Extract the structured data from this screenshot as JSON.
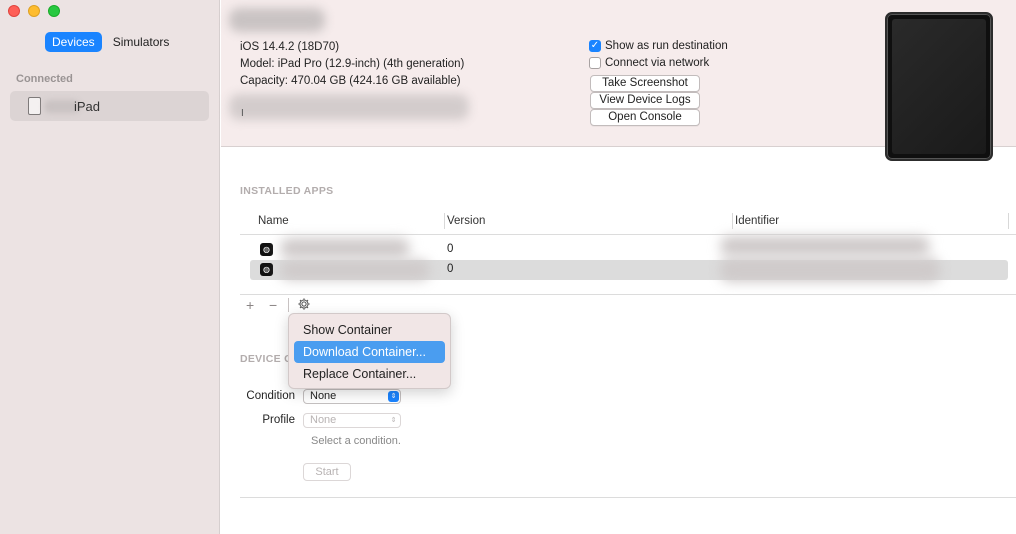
{
  "sidebar": {
    "segments": [
      "Devices",
      "Simulators"
    ],
    "section_label": "Connected",
    "device_label": "iPad"
  },
  "device_info": {
    "ios": "iOS 14.4.2 (18D70)",
    "model": "Model: iPad Pro (12.9-inch) (4th generation)",
    "capacity": "Capacity: 470.04 GB (424.16 GB available)",
    "partial_line_marker": "I"
  },
  "options": {
    "run_destination": {
      "label": "Show as run destination",
      "checked": true
    },
    "via_network": {
      "label": "Connect via network",
      "checked": false
    }
  },
  "buttons": {
    "screenshot": "Take Screenshot",
    "logs": "View Device Logs",
    "console": "Open Console"
  },
  "installed_apps": {
    "title": "INSTALLED APPS",
    "columns": [
      "Name",
      "Version",
      "Identifier"
    ],
    "rows": [
      {
        "version": "0"
      },
      {
        "version": "0",
        "selected": true
      }
    ],
    "controls": {
      "add": "+",
      "remove": "−"
    }
  },
  "context_menu": {
    "items": [
      "Show Container",
      "Download Container...",
      "Replace Container..."
    ],
    "highlighted": "Download Container..."
  },
  "device_conditions": {
    "title": "DEVICE C",
    "condition_label": "Condition",
    "condition_value": "None",
    "profile_label": "Profile",
    "profile_value": "None",
    "hint": "Select a condition.",
    "start": "Start"
  },
  "colors": {
    "accent": "#1a84ff",
    "menu_highlight": "#4a9df0",
    "sidebar_bg": "#ece3e3",
    "header_bg": "#f6ecec"
  }
}
